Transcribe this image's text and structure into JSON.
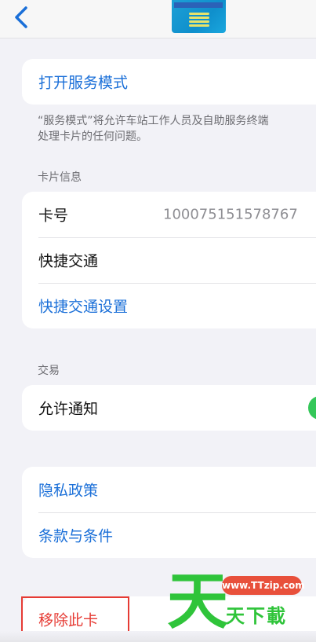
{
  "header": {
    "back_icon": "chevron-left-icon",
    "card_icon": "transit-card-thumbnail"
  },
  "service": {
    "open_label": "打开服务模式",
    "footnote_line1": "“服务模式”将允许车站工作人员及自助服务终端",
    "footnote_line2": "处理卡片的任何问题。"
  },
  "card_info": {
    "section_title": "卡片信息",
    "card_number_label": "卡号",
    "card_number_value": "100075151578767",
    "express_label": "快捷交通",
    "express_settings_label": "快捷交通设置"
  },
  "transactions": {
    "section_title": "交易",
    "notify_label": "允许通知",
    "notify_enabled": true
  },
  "legal": {
    "privacy_label": "隐私政策",
    "terms_label": "条款与条件"
  },
  "actions": {
    "remove_label": "移除此卡"
  },
  "watermark": {
    "big_char": "天",
    "url": "www.TTzip.com",
    "name": "天下載"
  },
  "colors": {
    "accent": "#1a6fd8",
    "destructive": "#e63b34",
    "toggle_on": "#34c759"
  }
}
